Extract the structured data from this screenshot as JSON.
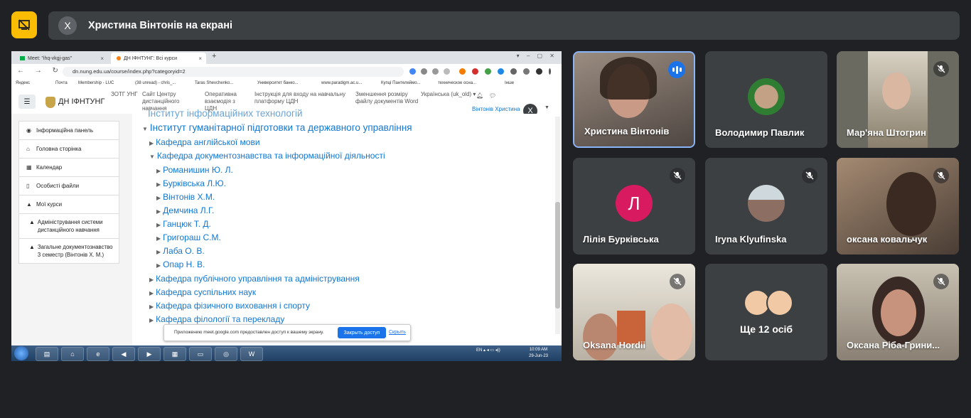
{
  "banner": {
    "title": "Христина Вінтонів на екрані",
    "close_label": "X"
  },
  "browser": {
    "tabs": [
      {
        "label": "Meet: \"ihq-vkgj-gas\"",
        "close": "×"
      },
      {
        "label": "ДН ІФНТУНГ: Всі курси",
        "close": "×"
      }
    ],
    "new_tab": "+",
    "url": "dn.nung.edu.ua/course/index.php?categoryid=2",
    "bookmarks": [
      "Яндекс",
      "Почта",
      "Membership - LUC",
      "(38 unread) - chris_...",
      "Taras Shevchenko...",
      "Университет банко...",
      "www.paradigm.ac.u...",
      "Купці Пантелеймо...",
      "техническое осна...",
      "Інше"
    ]
  },
  "moodle": {
    "site_name": "ДН ІФНТУНГ",
    "nav": [
      "ЗОТГ УНГ",
      "Сайт Центру дистанційного навчання",
      "Оперативна взаємодія з ЦДН",
      "Інструкція для входу на навчальну платформу ЦДН",
      "Зменшення розміру файлу документів Word",
      "Українська (uk_old) ▾"
    ],
    "user": "Вінтонів Христина",
    "presenter_initial": "X",
    "sidebar": [
      {
        "icon": "◉",
        "label": "Інформаційна панель"
      },
      {
        "icon": "⌂",
        "label": "Головна сторінка"
      },
      {
        "icon": "▦",
        "label": "Календар"
      },
      {
        "icon": "▯",
        "label": "Особисті файли"
      },
      {
        "icon": "▲",
        "label": "Мої курси"
      }
    ],
    "sidebar_courses": [
      "Адміністрування системи дистанційного навчання",
      "Загальне документознавство 3 семестр (Вінтонів Х. М.)"
    ],
    "tree": {
      "partial_top": "Інститут інформаційних технологій",
      "institute": "Інститут гуманітарної підготовки та державного управління",
      "dept_english": "Кафедра англійської мови",
      "dept_docs": "Кафедра документознавства та інформаційної діяльності",
      "people": [
        "Романишин Ю. Л.",
        "Бурківська Л.Ю.",
        "Вінтонів Х.М.",
        "Демчина Л.Г.",
        "Ганцюк Т. Д.",
        "Григораш С.М.",
        "Лаба О. В.",
        "Опар Н. В."
      ],
      "dept_public": "Кафедра публічного управління та адміністрування",
      "dept_social": "Кафедра суспільних наук",
      "dept_sport": "Кафедра фізичного виховання і спорту",
      "dept_philology": "Кафедра філології та перекладу"
    },
    "share_notice": {
      "text": "Приложению meet.google.com предоставлен доступ к вашему экрану.",
      "stop": "Закрыть доступ",
      "hide": "Скрыть"
    }
  },
  "taskbar": {
    "tray": "EN",
    "time": "10:09 AM",
    "date": "29-Jun-23"
  },
  "participants": [
    {
      "name": "Христина Вінтонів",
      "state": "speaking"
    },
    {
      "name": "Володимир Павлик",
      "state": "unmuted"
    },
    {
      "name": "Мар'яна Штогрин",
      "state": "muted"
    },
    {
      "name": "Лілія Бурківська",
      "state": "muted",
      "initial": "Л"
    },
    {
      "name": "Iryna Klyufinska",
      "state": "muted"
    },
    {
      "name": "оксана ковальчук",
      "state": "muted"
    },
    {
      "name": "Oksana Hordii",
      "state": "muted"
    },
    {
      "name": "Оксана Ріба-Грини...",
      "state": "muted"
    }
  ],
  "more_people": "Ще 12 осіб",
  "colors": {
    "background": "#202124",
    "tile": "#3c4043",
    "accent": "#fbbc04",
    "speaking": "#1a73e8",
    "avatar_l": "#d81b60"
  }
}
